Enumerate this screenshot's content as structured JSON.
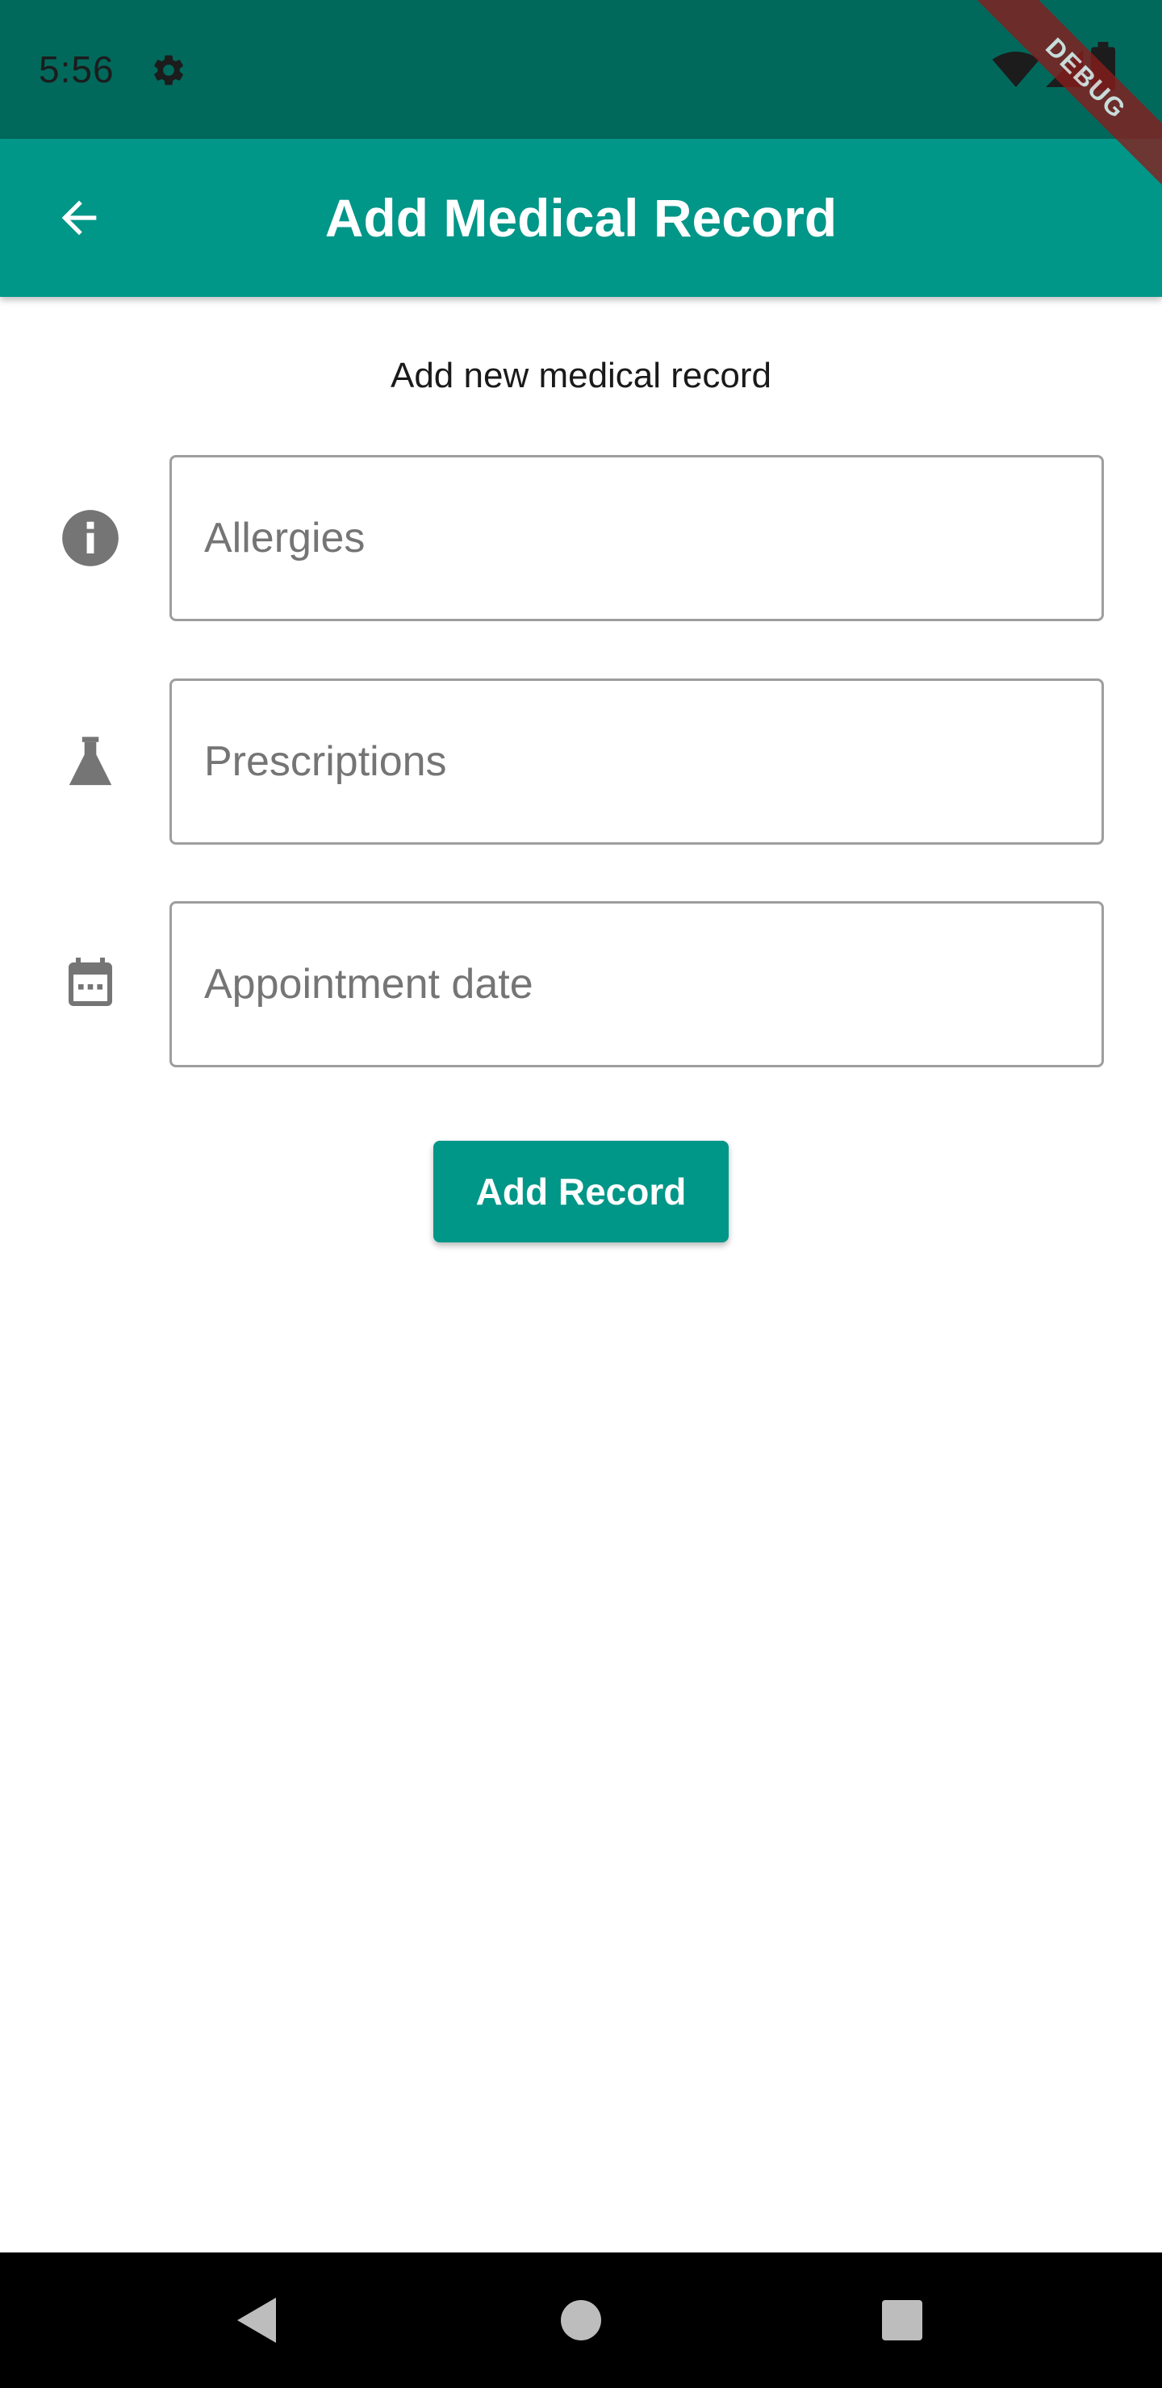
{
  "status_bar": {
    "time": "5:56",
    "icons": [
      "gear-icon",
      "wifi-icon",
      "signal-icon",
      "battery-icon"
    ]
  },
  "debug_banner": {
    "label": "DEBUG"
  },
  "app_bar": {
    "title": "Add Medical Record",
    "back_icon": "arrow-back-icon",
    "color": "#009688"
  },
  "content": {
    "subtitle": "Add new medical record",
    "fields": [
      {
        "icon": "info-icon",
        "placeholder": "Allergies",
        "value": ""
      },
      {
        "icon": "flask-icon",
        "placeholder": "Prescriptions",
        "value": ""
      },
      {
        "icon": "calendar-icon",
        "placeholder": "Appointment date",
        "value": ""
      }
    ],
    "submit_label": "Add Record"
  },
  "nav_bar": {
    "icons": [
      "nav-back-icon",
      "nav-home-icon",
      "nav-recents-icon"
    ]
  },
  "colors": {
    "status_bar": "#00695c",
    "primary": "#009688",
    "icon_grey": "#757575",
    "border_grey": "#9e9e9e"
  }
}
